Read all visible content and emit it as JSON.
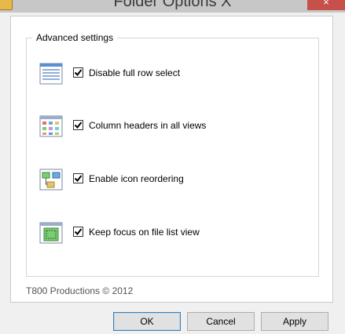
{
  "window": {
    "title": "Folder Options X",
    "close_glyph": "×"
  },
  "group": {
    "title": "Advanced settings"
  },
  "options": [
    {
      "icon": "details-view-icon",
      "label": "Disable full row select",
      "checked": true
    },
    {
      "icon": "column-grid-icon",
      "label": "Column headers in all views",
      "checked": true
    },
    {
      "icon": "icon-reorder-icon",
      "label": "Enable icon reordering",
      "checked": true
    },
    {
      "icon": "focus-list-icon",
      "label": "Keep focus on file list view",
      "checked": true
    }
  ],
  "footer": {
    "copyright": "T800 Productions © 2012"
  },
  "buttons": {
    "ok": "OK",
    "cancel": "Cancel",
    "apply": "Apply"
  },
  "colors": {
    "close_button": "#c7504b",
    "default_button_border": "#3c7fb1"
  }
}
